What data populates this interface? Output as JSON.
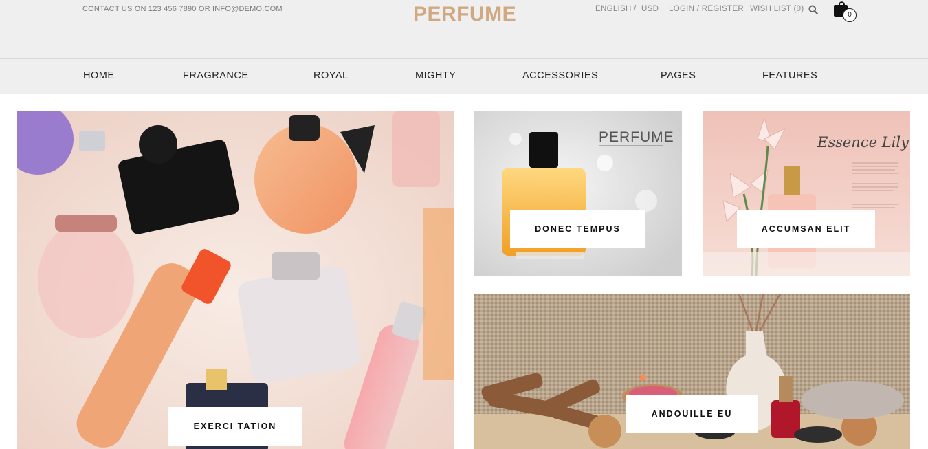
{
  "header": {
    "contact": "CONTACT US ON 123 456 7890 OR INFO@DEMO.COM",
    "logo": "PERFUME",
    "language": "ENGLISH",
    "separator": "/",
    "currency": "USD",
    "login": "LOGIN / REGISTER",
    "wishlist": "WISH LIST (0)",
    "cart_count": "0"
  },
  "nav": {
    "items": [
      "HOME",
      "FRAGRANCE",
      "ROYAL",
      "MIGHTY",
      "ACCESSORIES",
      "PAGES",
      "FEATURES"
    ]
  },
  "banners": {
    "main": {
      "label": "EXERCI TATION"
    },
    "top_left": {
      "label": "DONEC TEMPUS",
      "image_text": "PERFUME"
    },
    "top_right": {
      "label": "ACCUMSAN ELIT",
      "image_text": "Essence Lily"
    },
    "bottom": {
      "label": "ANDOUILLE EU"
    }
  },
  "colors": {
    "logo": "#d0a882",
    "header_bg": "#efefef"
  }
}
